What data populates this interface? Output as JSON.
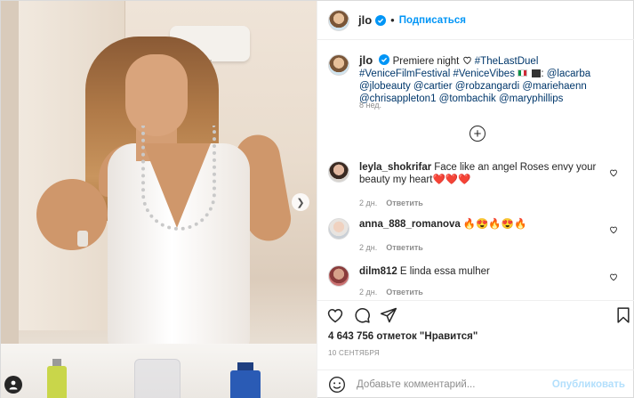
{
  "header": {
    "username": "jlo",
    "separator": "•",
    "follow_label": "Подписаться"
  },
  "caption": {
    "username": "jlo",
    "text_line1": "Premiere night",
    "hashtags_line1": "#TheLastDuel #VeniceFilmFestival",
    "text_line2": "#VeniceVibes",
    "mentions": "@lacarba @jlobeauty @cartier @robzangardi @mariehaenn @chrisappleton1 @tombachik @maryphillips",
    "time": "8 нед."
  },
  "comments": [
    {
      "username": "leyla_shokrifar",
      "text": "Face like an angel Roses envy your beauty my heart❤️❤️❤️",
      "time": "2 дн.",
      "reply_label": "Ответить"
    },
    {
      "username": "anna_888_romanova",
      "text": "🔥😍🔥😍🔥",
      "time": "2 дн.",
      "reply_label": "Ответить"
    },
    {
      "username": "dilm812",
      "text": "E linda essa mulher",
      "time": "2 дн.",
      "reply_label": "Ответить"
    }
  ],
  "likes_text": "4 643 756 отметок \"Нравится\"",
  "date_text": "10 СЕНТЯБРЯ",
  "add_comment": {
    "placeholder": "Добавьте комментарий...",
    "publish_label": "Опубликовать"
  },
  "icons": {
    "verified": "verified-badge-icon",
    "heart": "heart-icon",
    "comment": "comment-icon",
    "share": "share-icon",
    "save": "bookmark-icon",
    "emoji": "emoji-icon",
    "load_more": "plus-circle-icon",
    "next": "chevron-right-icon",
    "tag": "person-tag-icon"
  },
  "colors": {
    "accent": "#0095f6",
    "link": "#00376b",
    "muted": "#8e8e8e",
    "publish_disabled": "#b2dffc"
  }
}
